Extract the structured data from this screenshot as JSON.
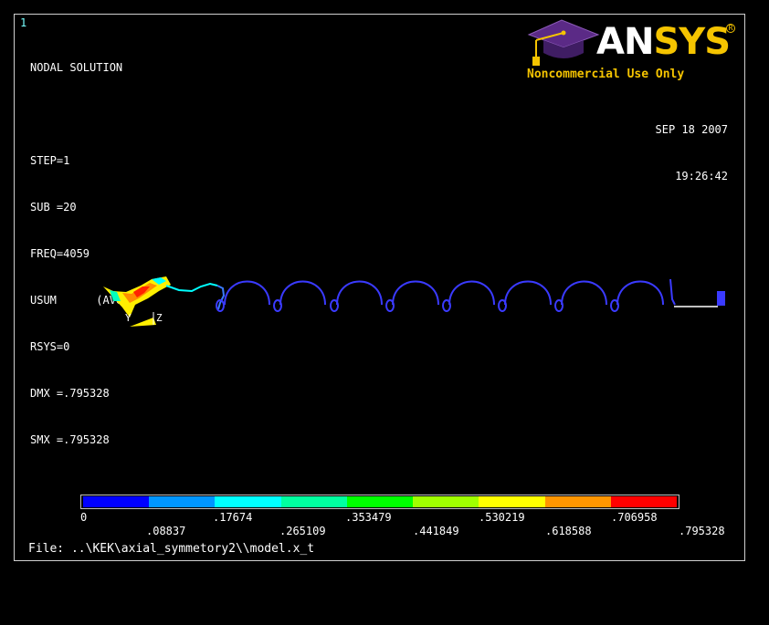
{
  "window_number": "1",
  "info_lines": [
    "NODAL SOLUTION",
    "",
    "STEP=1",
    "SUB =20",
    "FREQ=4059",
    "USUM      (AVG)",
    "RSYS=0",
    "DMX =.795328",
    "SMX =.795328"
  ],
  "date": "SEP 18 2007",
  "time": "19:26:42",
  "logo": {
    "brand_an": "AN",
    "brand_sys": "SYS",
    "tagline": "Noncommercial Use Only",
    "icon": "graduation-cap-icon"
  },
  "axes": {
    "y_label": "Y",
    "z_label": "Z"
  },
  "legend": {
    "colors": [
      "#0000ff",
      "#0096ff",
      "#00ffff",
      "#00ffa0",
      "#00ff00",
      "#a0ff00",
      "#ffff00",
      "#ff9600",
      "#ff0000"
    ],
    "top_ticks": [
      "0",
      ".17674",
      ".353479",
      ".530219",
      ".706958"
    ],
    "bottom_ticks": [
      ".08837",
      ".265109",
      ".441849",
      ".618588",
      ".795328"
    ]
  },
  "file_label": "File: ..\\KEK\\axial_symmetory2\\\\model.x_t",
  "model_colors": {
    "cell": "#3a3aff",
    "beam_pipe": "#ffffff"
  }
}
